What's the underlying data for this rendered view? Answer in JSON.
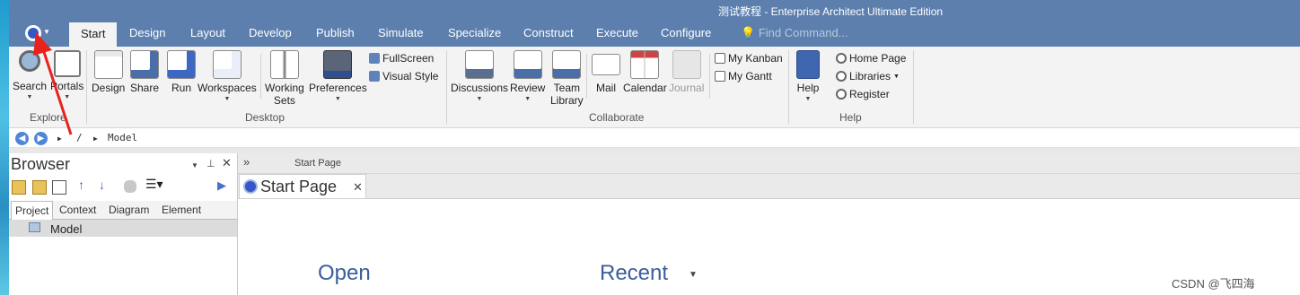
{
  "window": {
    "title": "测试教程 - Enterprise Architect Ultimate Edition"
  },
  "tabs": [
    {
      "label": "Start"
    },
    {
      "label": "Design"
    },
    {
      "label": "Layout"
    },
    {
      "label": "Develop"
    },
    {
      "label": "Publish"
    },
    {
      "label": "Simulate"
    },
    {
      "label": "Specialize"
    },
    {
      "label": "Construct"
    },
    {
      "label": "Execute"
    },
    {
      "label": "Configure"
    }
  ],
  "find_command": {
    "placeholder": "Find Command..."
  },
  "ribbon": {
    "explore": {
      "search": "Search",
      "portals": "Portals",
      "group": "Explore"
    },
    "desktop": {
      "design": "Design",
      "share": "Share",
      "run": "Run",
      "workspaces": "Workspaces",
      "working_sets_1": "Working",
      "working_sets_2": "Sets",
      "preferences": "Preferences",
      "fullscreen": "FullScreen",
      "visual_style": "Visual Style",
      "group": "Desktop"
    },
    "collaborate": {
      "discussions": "Discussions",
      "review": "Review",
      "team_1": "Team",
      "team_2": "Library",
      "mail": "Mail",
      "calendar": "Calendar",
      "journal": "Journal",
      "my_kanban": "My Kanban",
      "my_gantt": "My Gantt",
      "group": "Collaborate"
    },
    "help": {
      "help": "Help",
      "home_page": "Home Page",
      "libraries": "Libraries",
      "register": "Register",
      "group": "Help"
    }
  },
  "navbar": {
    "separator": "/",
    "path": "Model"
  },
  "browser": {
    "title": "Browser",
    "tabs": [
      {
        "label": "Project"
      },
      {
        "label": "Context"
      },
      {
        "label": "Diagram"
      },
      {
        "label": "Element"
      }
    ],
    "tree": [
      {
        "label": "Model"
      }
    ]
  },
  "main": {
    "header_label": "Start Page",
    "doc_tab": "Start Page",
    "open_heading": "Open",
    "recent_heading": "Recent"
  },
  "watermark": "CSDN @飞四海",
  "colors": {
    "titlebar": "#5c7fae",
    "ribbon": "#f3f3f3",
    "accent": "#3a5d9c",
    "arrow": "#e8221c"
  }
}
